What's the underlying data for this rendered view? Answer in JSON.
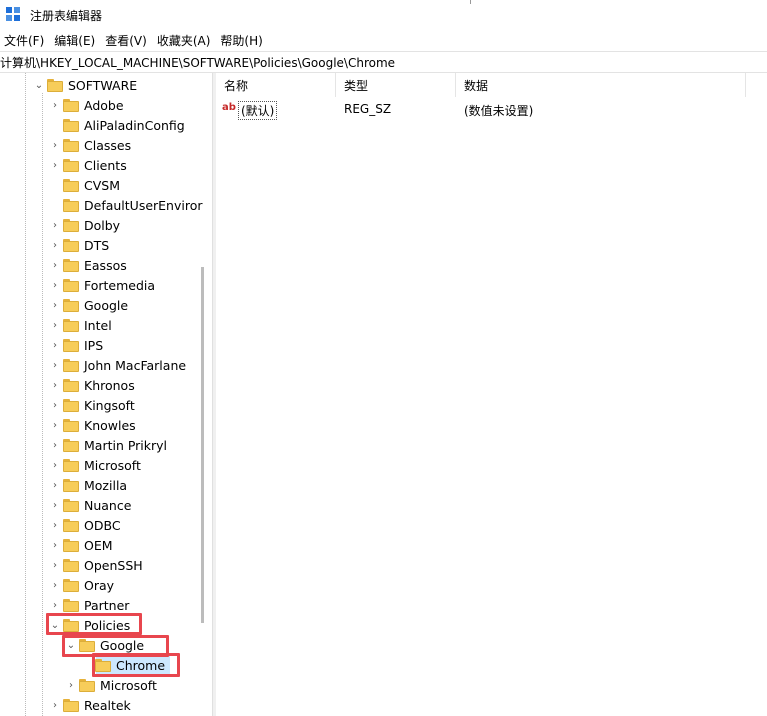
{
  "window": {
    "title": "注册表编辑器"
  },
  "menu": [
    "文件(F)",
    "编辑(E)",
    "查看(V)",
    "收藏夹(A)",
    "帮助(H)"
  ],
  "address": "计算机\\HKEY_LOCAL_MACHINE\\SOFTWARE\\Policies\\Google\\Chrome",
  "tree": {
    "root": "SOFTWARE",
    "items": [
      {
        "label": "Adobe",
        "expander": "collapsed"
      },
      {
        "label": "AliPaladinConfig",
        "expander": "none"
      },
      {
        "label": "Classes",
        "expander": "collapsed"
      },
      {
        "label": "Clients",
        "expander": "collapsed"
      },
      {
        "label": "CVSM",
        "expander": "none"
      },
      {
        "label": "DefaultUserEnviror",
        "expander": "none"
      },
      {
        "label": "Dolby",
        "expander": "collapsed"
      },
      {
        "label": "DTS",
        "expander": "collapsed"
      },
      {
        "label": "Eassos",
        "expander": "collapsed"
      },
      {
        "label": "Fortemedia",
        "expander": "collapsed"
      },
      {
        "label": "Google",
        "expander": "collapsed"
      },
      {
        "label": "Intel",
        "expander": "collapsed"
      },
      {
        "label": "IPS",
        "expander": "collapsed"
      },
      {
        "label": "John MacFarlane",
        "expander": "collapsed"
      },
      {
        "label": "Khronos",
        "expander": "collapsed"
      },
      {
        "label": "Kingsoft",
        "expander": "collapsed"
      },
      {
        "label": "Knowles",
        "expander": "collapsed"
      },
      {
        "label": "Martin Prikryl",
        "expander": "collapsed"
      },
      {
        "label": "Microsoft",
        "expander": "collapsed"
      },
      {
        "label": "Mozilla",
        "expander": "collapsed"
      },
      {
        "label": "Nuance",
        "expander": "collapsed"
      },
      {
        "label": "ODBC",
        "expander": "collapsed"
      },
      {
        "label": "OEM",
        "expander": "collapsed"
      },
      {
        "label": "OpenSSH",
        "expander": "collapsed"
      },
      {
        "label": "Oray",
        "expander": "collapsed"
      },
      {
        "label": "Partner",
        "expander": "collapsed"
      },
      {
        "label": "Policies",
        "expander": "expanded"
      }
    ],
    "policies_children": {
      "google": "Google",
      "chrome": "Chrome",
      "microsoft": "Microsoft"
    },
    "after": "Realtek"
  },
  "values": {
    "columns": [
      "名称",
      "类型",
      "数据"
    ],
    "rows": [
      {
        "name": "(默认)",
        "type": "REG_SZ",
        "data": "(数值未设置)"
      }
    ]
  },
  "colors": {
    "highlight_box": "#e8464e",
    "folder": "#f7cd5a",
    "selection": "#cce8ff"
  }
}
